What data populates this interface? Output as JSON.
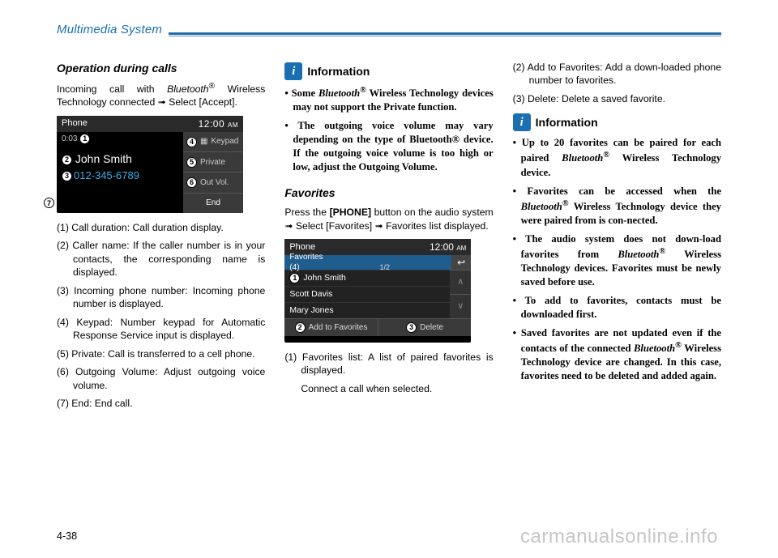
{
  "header": {
    "title": "Multimedia System"
  },
  "col1": {
    "subhead": "Operation during calls",
    "intro_a": "Incoming call with ",
    "intro_b_italic": "Bluetooth",
    "intro_b_sup": "®",
    "intro_c": " Wireless Technology connected ➟ Select [Accept].",
    "shot": {
      "title": "Phone",
      "time_h": "12:00",
      "time_ampm": "AM",
      "duration": "0:03",
      "caller": "John Smith",
      "number": "012-345-6789",
      "btn_keypad": "Keypad",
      "btn_private": "Private",
      "btn_outvol": "Out Vol.",
      "btn_end": "End"
    },
    "n1": "(1) Call duration: Call duration display.",
    "n2": "(2) Caller name: If the caller number is in your contacts, the corresponding name is displayed.",
    "n3": "(3) Incoming phone number: Incoming phone number is displayed.",
    "n4": "(4) Keypad: Number keypad for Automatic Response Service input is displayed.",
    "n5": "(5) Private: Call is transferred to a cell phone.",
    "n6": "(6) Outgoing Volume: Adjust outgoing voice volume.",
    "n7": "(7) End: End call."
  },
  "col2": {
    "info_label": "Information",
    "b1_a": "• Some ",
    "b1_b_italic": "Bluetooth",
    "b1_sup": "®",
    "b1_c": " Wireless Technology devices may not support the Private function.",
    "b2": "• The outgoing voice volume may vary depending on the type of Bluetooth® device. If the outgoing voice volume is too high or low, adjust the Outgoing Volume.",
    "subhead2": "Favorites",
    "fav_intro_a": "Press the ",
    "fav_intro_b_bold": "[PHONE]",
    "fav_intro_c": " button on the audio system ➟ Select [Favorites] ➟ Favorites list displayed.",
    "shot": {
      "title": "Phone",
      "time_h": "12:00",
      "time_ampm": "AM",
      "subtitle": "Favorites (4)",
      "page": "1/2",
      "row1": "John Smith",
      "row2": "Scott Davis",
      "row3": "Mary Jones",
      "btn_add": "Add to Favorites",
      "btn_del": "Delete"
    },
    "n1": "(1) Favorites list: A list of paired favorites is displayed.",
    "n1b": "Connect a call when selected."
  },
  "col3": {
    "n2": "(2) Add to Favorites: Add a down-loaded phone number to favorites.",
    "n3": "(3) Delete: Delete a saved favorite.",
    "info_label": "Information",
    "b1_a": "• Up to 20 favorites can be paired for each paired ",
    "b1_b_italic": "Bluetooth",
    "b1_sup": "®",
    "b1_c": " Wireless Technology device.",
    "b2_a": "• Favorites can be accessed when the ",
    "b2_b_italic": "Bluetooth",
    "b2_sup": "®",
    "b2_c": " Wireless Technology device they were paired from is con-nected.",
    "b3_a": "• The audio system does not down-load favorites from ",
    "b3_b_italic": "Bluetooth",
    "b3_sup": "®",
    "b3_c": " Wireless Technology devices. Favorites must be newly saved before use.",
    "b4": "• To add to favorites, contacts must be downloaded first.",
    "b5_a": "• Saved favorites are not updated even if the contacts of the connected ",
    "b5_b_italic": "Bluetooth",
    "b5_sup": "®",
    "b5_c": " Wireless Technology device are changed. In this case, favorites need to be deleted and added again."
  },
  "footer": {
    "pagenum": "4-38"
  },
  "watermark": "carmanualsonline.info"
}
